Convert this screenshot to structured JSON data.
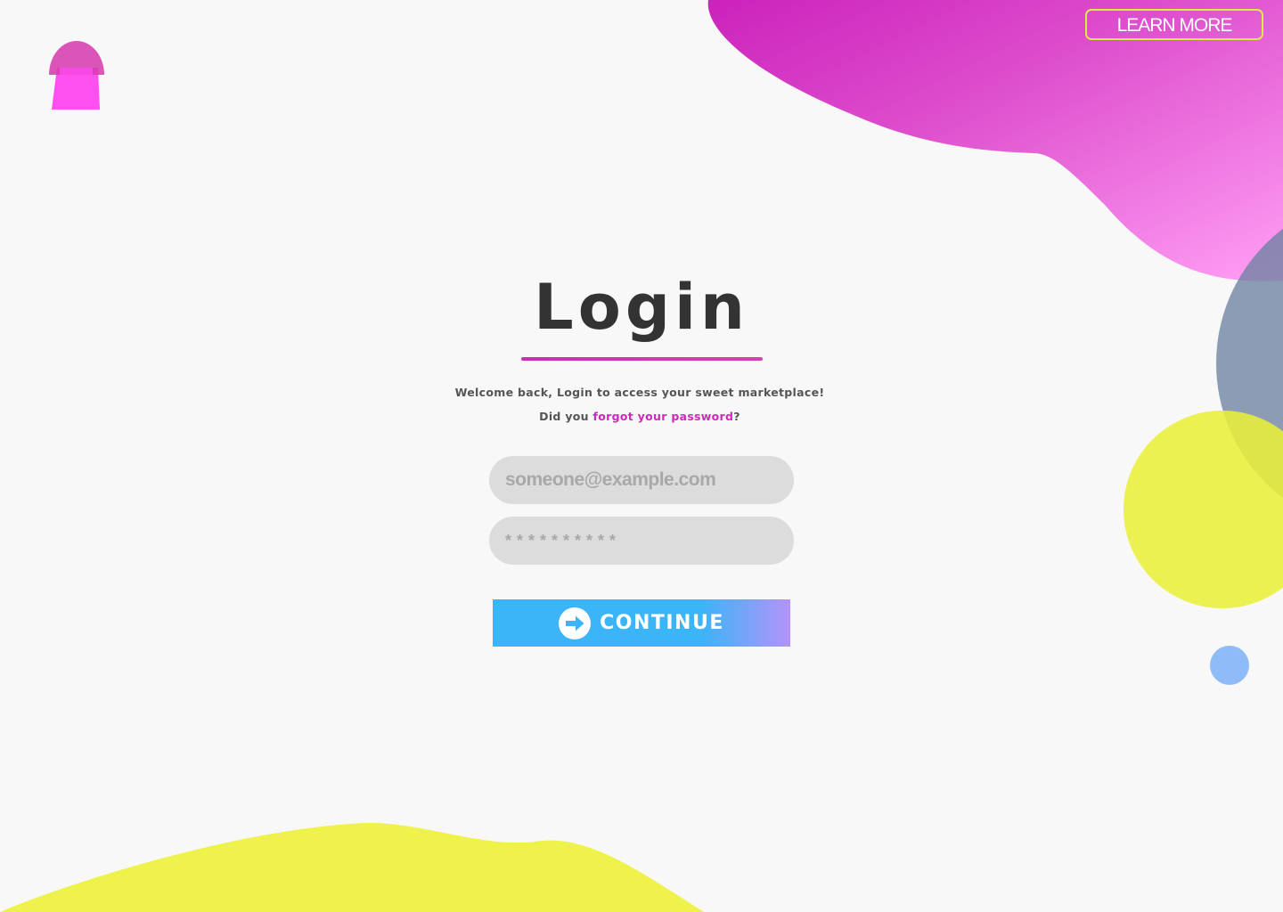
{
  "brand": {
    "logo": "mushroom-logo-icon",
    "colors": {
      "magenta": "#cc22bb",
      "pink": "#f06ee8",
      "yellow": "#eef24a",
      "slate": "#7f93aa",
      "blue": "#3cb4f8",
      "violet": "#b393f9"
    }
  },
  "header": {
    "learn_more_label": "LEARN MORE"
  },
  "login": {
    "title": "Login",
    "welcome_text": "Welcome back, Login to access your sweet marketplace!",
    "forgot_prefix": "Did you ",
    "forgot_link": "forgot your password",
    "forgot_suffix": "?",
    "email_placeholder": "someone@example.com",
    "password_placeholder": "**********",
    "continue_label": "CONTINUE",
    "continue_icon": "arrow-right-circle-icon"
  }
}
